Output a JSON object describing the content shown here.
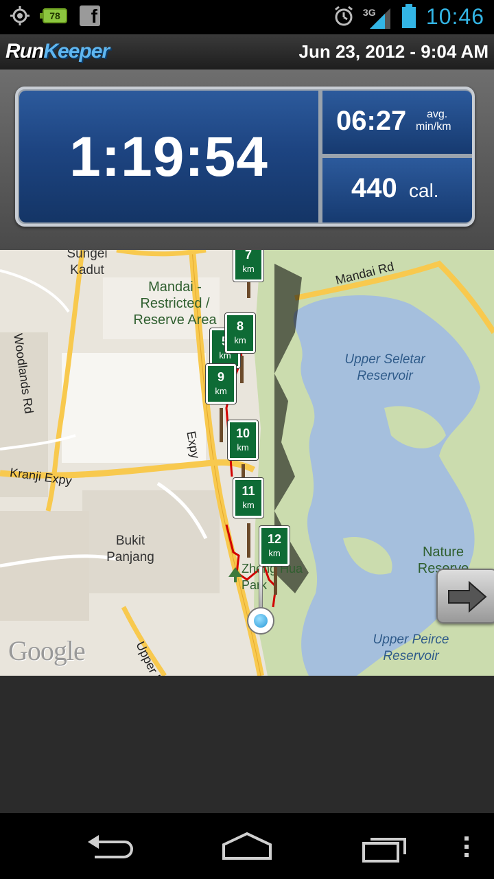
{
  "status_bar": {
    "icons_left": [
      "gps-icon",
      "battery-level-icon",
      "facebook-icon"
    ],
    "battery_badge": "78",
    "icons_right": [
      "alarm-icon",
      "signal-3g-icon",
      "battery-icon"
    ],
    "network": "3G",
    "clock": "10:46",
    "clock_color": "#33b5e5"
  },
  "header": {
    "logo_run": "Run",
    "logo_keeper": "Keeper",
    "date_time": "Jun 23, 2012 - 9:04 AM"
  },
  "stats": {
    "duration": "1:19:54",
    "pace": "06:27",
    "pace_unit_top": "avg.",
    "pace_unit_bottom": "min/km",
    "calories": "440",
    "calories_unit": "cal."
  },
  "map": {
    "labels": {
      "sungei_kadut_1": "Sungei",
      "sungei_kadut_2": "Kadut",
      "mandai_1": "Mandai -",
      "mandai_2": "Restricted /",
      "mandai_3": "Reserve Area",
      "mandai_rd": "Mandai Rd",
      "woodlands_rd": "Woodlands Rd",
      "upper_seletar_1": "Upper Seletar",
      "upper_seletar_2": "Reservoir",
      "expy": "Expy",
      "kranji_expy": "Kranji Expy",
      "bukit_1": "Bukit",
      "bukit_2": "Panjang",
      "nature_1": "Nature",
      "nature_2": "Reserve",
      "zhenghua_1": "Zheng Hua",
      "zhenghua_2": "Park",
      "upper_peirce_1": "Upper Peirce",
      "upper_peirce_2": "Reservoir",
      "upper_bukit": "Upper B",
      "google": "Google"
    },
    "km_markers": [
      {
        "n": "7",
        "unit": "km"
      },
      {
        "n": "8",
        "unit": "km"
      },
      {
        "n": "5",
        "unit": "km"
      },
      {
        "n": "9",
        "unit": "km"
      },
      {
        "n": "10",
        "unit": "km"
      },
      {
        "n": "11",
        "unit": "km"
      },
      {
        "n": "12",
        "unit": "km"
      }
    ],
    "colors": {
      "water": "#a5bfdd",
      "park": "#cbdcae",
      "highway": "#f8c94e",
      "route": "#d20000",
      "marker": "#0e6b35"
    }
  },
  "navigation": {
    "next_button": "arrow-right-icon",
    "nav_buttons": [
      "back-icon",
      "home-icon",
      "recent-apps-icon",
      "menu-icon"
    ]
  }
}
